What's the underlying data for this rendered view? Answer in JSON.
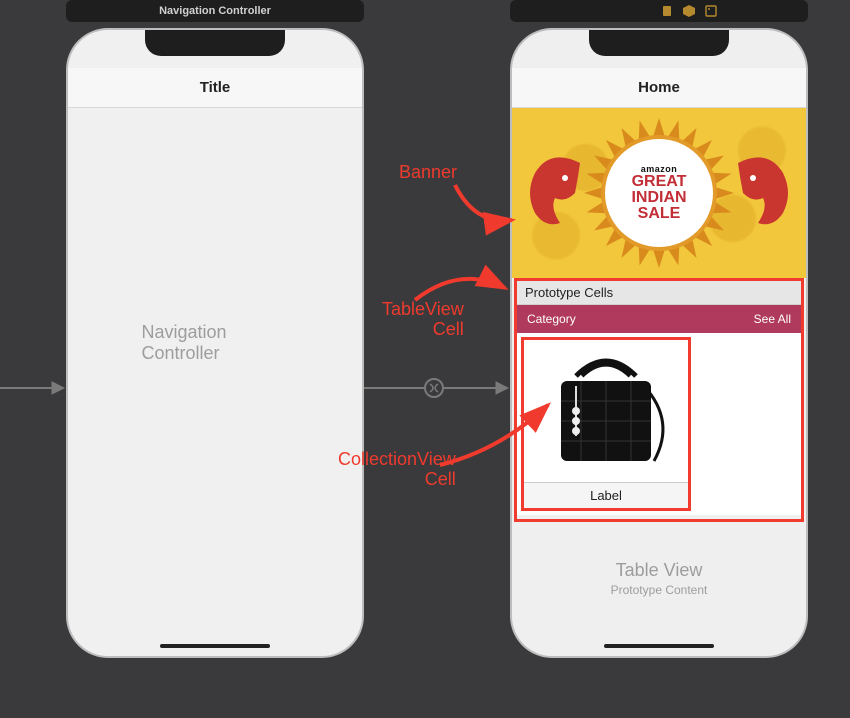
{
  "scene_titles": {
    "left": "Navigation Controller",
    "right_icons": [
      "document-icon",
      "cube-icon",
      "image-icon"
    ]
  },
  "left_phone": {
    "nav_title": "Title",
    "placeholder": "Navigation Controller"
  },
  "right_phone": {
    "nav_title": "Home",
    "banner": {
      "brand": "amazon",
      "line1": "GREAT",
      "line2": "INDIAN",
      "line3": "SALE"
    },
    "prototype_header": "Prototype Cells",
    "category_bar": {
      "title": "Category",
      "see_all": "See All"
    },
    "cell_label": "Label",
    "tableview_placeholder": {
      "title": "Table View",
      "subtitle": "Prototype Content"
    }
  },
  "annotations": {
    "banner": "Banner",
    "tableview_cell_l1": "TableView",
    "tableview_cell_l2": "Cell",
    "collectionview_cell_l1": "CollectionView",
    "collectionview_cell_l2": "Cell"
  }
}
